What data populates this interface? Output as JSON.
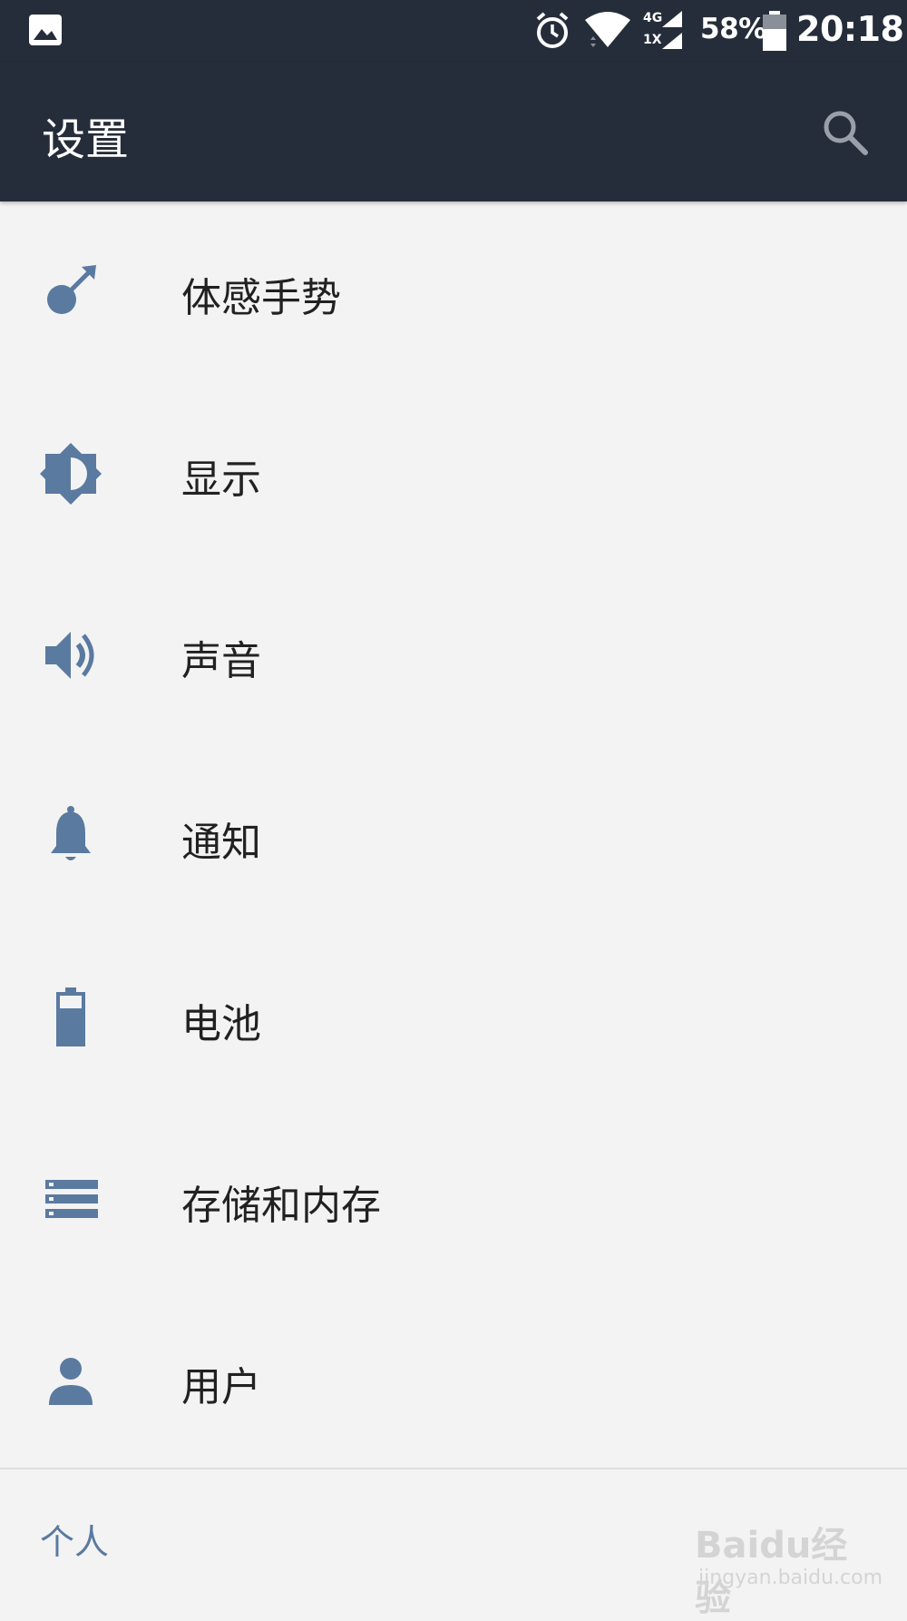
{
  "status_bar": {
    "network_top": "4G",
    "network_bottom": "1X",
    "battery_percent": "58%",
    "time": "20:18",
    "icons": [
      "image-notification-icon",
      "alarm-icon",
      "wifi-icon",
      "cell-signal-icon",
      "battery-icon"
    ]
  },
  "app_bar": {
    "title": "设置",
    "search_icon": "search-icon"
  },
  "colors": {
    "app_bar_bg": "#262d3a",
    "list_bg": "#f3f3f3",
    "icon_accent": "#5a7aa0",
    "text_primary": "#212121"
  },
  "settings_items": [
    {
      "label": "体感手势",
      "icon": "gesture-icon"
    },
    {
      "label": "显示",
      "icon": "brightness-icon"
    },
    {
      "label": "声音",
      "icon": "volume-icon"
    },
    {
      "label": "通知",
      "icon": "bell-icon"
    },
    {
      "label": "电池",
      "icon": "battery-icon"
    },
    {
      "label": "存储和内存",
      "icon": "storage-icon"
    },
    {
      "label": "用户",
      "icon": "person-icon"
    }
  ],
  "section": {
    "label": "个人"
  },
  "watermark": {
    "text": "Baidu经验",
    "sub": "jingyan.baidu.com"
  }
}
